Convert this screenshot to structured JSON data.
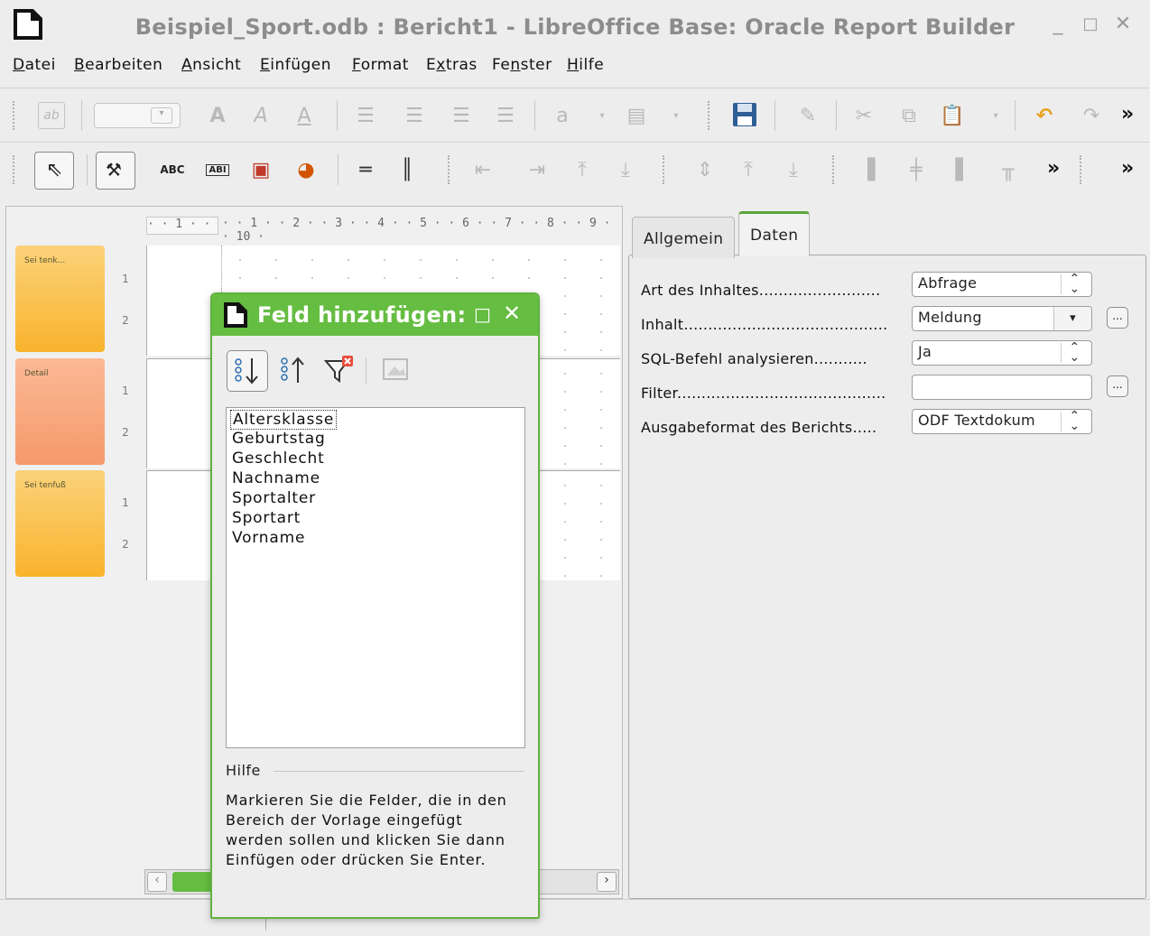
{
  "window": {
    "title": "Beispiel_Sport.odb : Bericht1 - LibreOffice Base: Oracle Report Builder",
    "controls": [
      "_",
      "□",
      "✕"
    ]
  },
  "menu": [
    {
      "label": "Datei",
      "hotkey": "D"
    },
    {
      "label": "Bearbeiten",
      "hotkey": "B"
    },
    {
      "label": "Ansicht",
      "hotkey": "A"
    },
    {
      "label": "Einfügen",
      "hotkey": "E"
    },
    {
      "label": "Format",
      "hotkey": "F"
    },
    {
      "label": "Extras",
      "hotkey": "x"
    },
    {
      "label": "Fenster",
      "hotkey": "n"
    },
    {
      "label": "Hilfe",
      "hotkey": "H"
    }
  ],
  "toolbar2": {
    "text_abc": "ABC",
    "text_field": "ABI",
    "more": "»"
  },
  "toolbar1": {
    "more": "»"
  },
  "ruler": {
    "left_segment": "· · 1 · ·",
    "main": "· · 1 · · 2 · · 3 · · 4 · · 5 · · 6 · · 7 · · 8 · · 9 · · 10 ·"
  },
  "sections": [
    {
      "label": "Sei tenk...",
      "color": "#f9b32d"
    },
    {
      "label": "Detail",
      "color": "#f5996b"
    },
    {
      "label": "Sei tenfuß",
      "color": "#f9b32d"
    }
  ],
  "vruler_marks": [
    "1",
    "2"
  ],
  "properties": {
    "tabs": [
      "Allgemein",
      "Daten"
    ],
    "active_tab": "Daten",
    "rows": [
      {
        "label": "Art des Inhaltes.........................",
        "value": "Abfrage",
        "control": "spin"
      },
      {
        "label": "Inhalt..........................................",
        "value": "Meldung",
        "control": "dropdown"
      },
      {
        "label": "SQL-Befehl analysieren...........",
        "value": "Ja",
        "control": "spin"
      },
      {
        "label": "Filter...........................................",
        "value": "",
        "control": "text"
      },
      {
        "label": "Ausgabeformat des Berichts.....",
        "value": "ODF Textdokum",
        "control": "spin"
      }
    ],
    "ellipsis": "..."
  },
  "dialog": {
    "title": "Feld hinzufügen:",
    "fields": [
      "Altersklasse",
      "Geburtstag",
      "Geschlecht",
      "Nachname",
      "Sportalter",
      "Sportart",
      "Vorname"
    ],
    "selected_field": "Altersklasse",
    "help_heading": "Hilfe",
    "help_text": "Markieren Sie die Felder, die in den Bereich der Vorlage eingefügt werden sollen und klicken Sie dann Einfügen oder drücken Sie Enter."
  },
  "colors": {
    "dialog_green": "#65bd41",
    "section_orange": "#f9b32d",
    "section_salmon": "#f5996b",
    "tab_active_accent": "#5aa53a"
  }
}
